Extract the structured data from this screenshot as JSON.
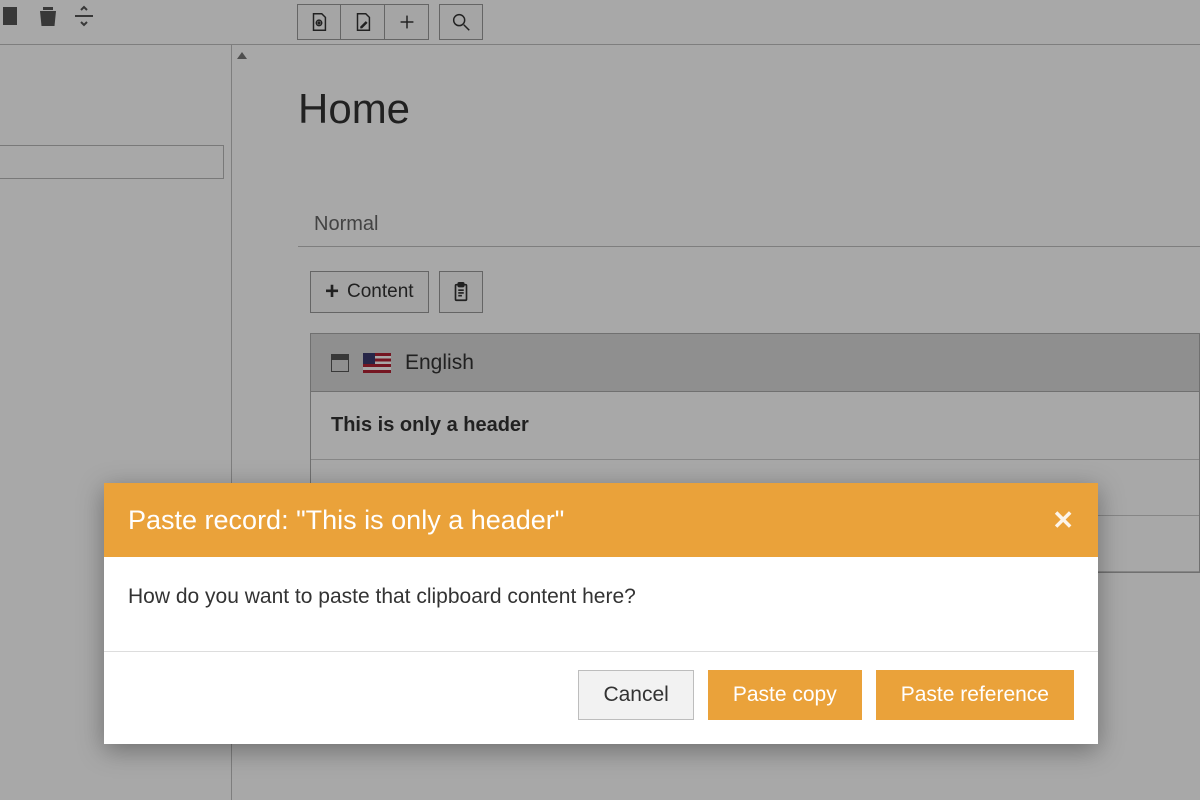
{
  "colors": {
    "accent": "#eaa23a"
  },
  "toolbar": {
    "left_icons": [
      "square-icon",
      "trash-icon",
      "divider-icon"
    ],
    "center_icons": [
      "page-view-icon",
      "page-edit-icon",
      "plus-icon",
      "search-icon"
    ]
  },
  "page": {
    "title": "Home",
    "format_label": "Normal"
  },
  "content_button": {
    "label": "Content"
  },
  "record": {
    "language_label": "English",
    "header_text": "This is only a header"
  },
  "modal": {
    "title": "Paste record: \"This is only a header\"",
    "body": "How do you want to paste that clipboard content here?",
    "cancel": "Cancel",
    "paste_copy": "Paste copy",
    "paste_reference": "Paste reference"
  }
}
